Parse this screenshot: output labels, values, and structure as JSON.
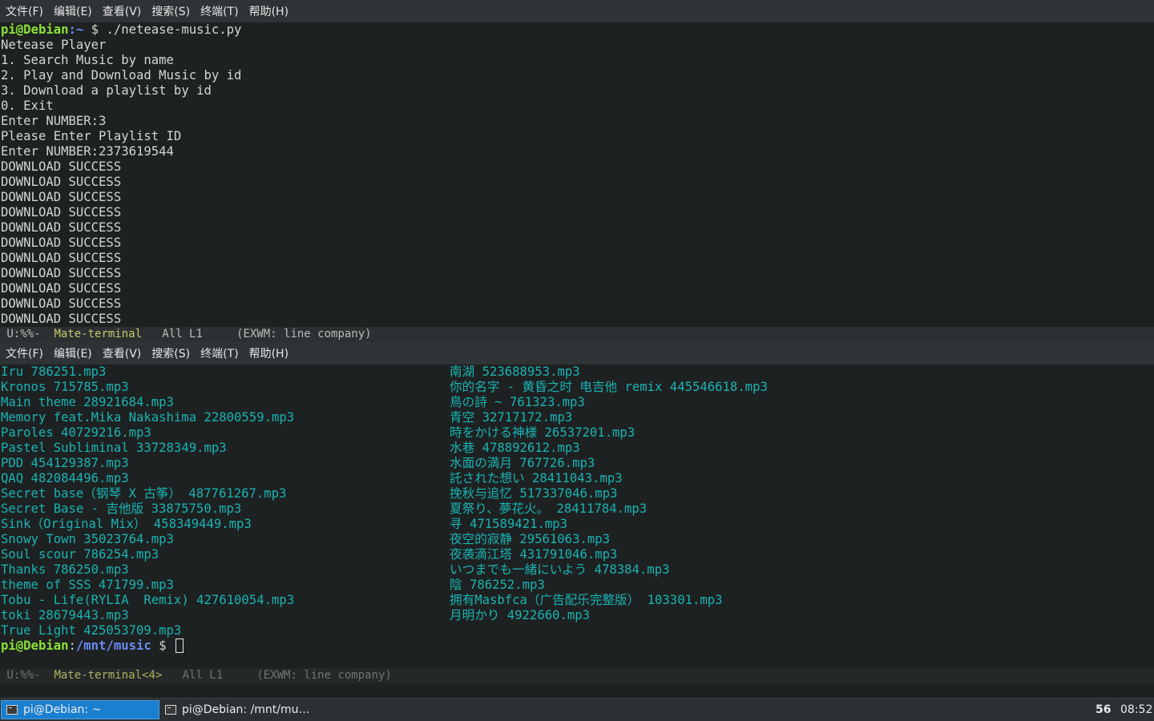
{
  "menu": [
    "文件(F)",
    "编辑(E)",
    "查看(V)",
    "搜索(S)",
    "终端(T)",
    "帮助(H)"
  ],
  "top_terminal": {
    "prompt": {
      "user": "pi@Debian",
      "path": ":~",
      "symbol": " $ ",
      "command": "./netease-music.py"
    },
    "lines": [
      "Netease Player",
      "1. Search Music by name",
      "2. Play and Download Music by id",
      "3. Download a playlist by id",
      "0. Exit",
      "Enter NUMBER:3",
      "Please Enter Playlist ID",
      "Enter NUMBER:2373619544",
      "DOWNLOAD SUCCESS",
      "DOWNLOAD SUCCESS",
      "DOWNLOAD SUCCESS",
      "DOWNLOAD SUCCESS",
      "DOWNLOAD SUCCESS",
      "DOWNLOAD SUCCESS",
      "DOWNLOAD SUCCESS",
      "DOWNLOAD SUCCESS",
      "DOWNLOAD SUCCESS",
      "DOWNLOAD SUCCESS",
      "DOWNLOAD SUCCESS"
    ]
  },
  "modeline_top": {
    "status": " U:%%-  ",
    "buffer": "Mate-terminal",
    "rest": "   All L1     (EXWM: line company)"
  },
  "bottom_terminal": {
    "left_files": [
      "Iru 786251.mp3",
      "Kronos 715785.mp3",
      "Main theme 28921684.mp3",
      "Memory feat.Mika Nakashima 22800559.mp3",
      "Paroles 40729216.mp3",
      "Pastel Subliminal 33728349.mp3",
      "PDD 454129387.mp3",
      "QAQ 482084496.mp3",
      "Secret base（钢琴 X 古筝） 487761267.mp3",
      "Secret Base - 吉他版 33875750.mp3",
      "Sink（Original Mix） 458349449.mp3",
      "Snowy Town 35023764.mp3",
      "Soul scour 786254.mp3",
      "Thanks 786250.mp3",
      "theme of SSS 471799.mp3",
      "Tobu - Life(RYLIA  Remix) 427610054.mp3",
      "toki 28679443.mp3",
      "True Light 425053709.mp3"
    ],
    "right_files": [
      "南湖 523688953.mp3",
      "你的名字 - 黄昏之时 电吉他 remix 445546618.mp3",
      "鳥の詩 ~ 761323.mp3",
      "青空 32717172.mp3",
      "時をかける神様 26537201.mp3",
      "水巷 478892612.mp3",
      "水面の満月 767726.mp3",
      "託された想い 28411043.mp3",
      "挽秋与追忆 517337046.mp3",
      "夏祭り、夢花火。 28411784.mp3",
      "寻 471589421.mp3",
      "夜空的寂静 29561063.mp3",
      "夜袭滴江塔 431791046.mp3",
      "いつまでも一緒にいよう 478384.mp3",
      "陰 786252.mp3",
      "拥有Masbfca（广告配乐完整版） 103301.mp3",
      "月明かり 4922660.mp3"
    ],
    "prompt": {
      "user": "pi@Debian",
      "sep": ":",
      "path": "/mnt/music",
      "symbol": " $ "
    }
  },
  "modeline_bottom": {
    "status": " U:%%-  ",
    "buffer": "Mate-terminal<4>",
    "rest": "   All L1     (EXWM: line company)"
  },
  "taskbar": {
    "tasks": [
      {
        "label": "pi@Debian: ~",
        "active": true
      },
      {
        "label": "pi@Debian: /mnt/mu…",
        "active": false
      }
    ],
    "workspace": "56",
    "clock": "08:52"
  },
  "colors": {
    "background": "#1e2122",
    "prompt_user": "#8ae234",
    "prompt_path": "#6a8cf0",
    "file": "#19b3b3",
    "taskbar_active": "#1b7fd0"
  }
}
